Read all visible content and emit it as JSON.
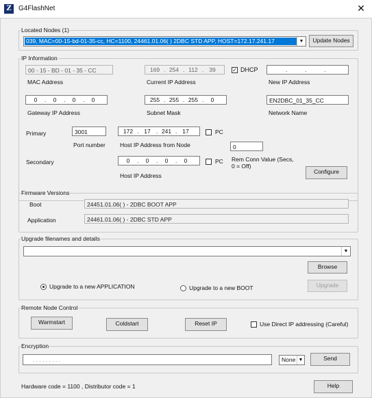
{
  "window": {
    "title": "G4FlashNet",
    "icon": "app-logo-icon",
    "close_glyph": "✕"
  },
  "nodes": {
    "legend": "Located Nodes (1)",
    "selected": "039, MAC=00-15-bd-01-35-cc, HC=1100, 24461.01.06(   ) 2DBC STD APP, HOST=172.17.241.17",
    "update_button": "Update Nodes"
  },
  "ip": {
    "legend": "IP Information",
    "mac_value": "00 - 15 - BD - 01 - 35 - CC",
    "mac_label": "MAC Address",
    "current_ip": [
      "169",
      "254",
      "112",
      "39"
    ],
    "current_ip_label": "Current IP Address",
    "dhcp_label": "DHCP",
    "dhcp_checked": true,
    "new_ip": [
      "",
      "",
      "",
      ""
    ],
    "new_ip_label": "New IP Address",
    "gateway_ip": [
      "0",
      "0",
      "0",
      "0"
    ],
    "gateway_label": "Gateway IP Address",
    "subnet": [
      "255",
      "255",
      "255",
      "0"
    ],
    "subnet_label": "Subnet Mask",
    "network_name": "EN2DBC_01_35_CC",
    "network_name_label": "Network Name",
    "primary_label": "Primary",
    "port_number": "3001",
    "port_label": "Port number",
    "host_ip": [
      "172",
      "17",
      "241",
      "17"
    ],
    "host_ip_label": "Host IP Address from Node",
    "pc_label": "PC",
    "rem_conn_value": "0",
    "rem_conn_label": "Rem Conn Value (Secs, 0 = Off)",
    "secondary_label": "Secondary",
    "secondary_ip": [
      "0",
      "0",
      "0",
      "0"
    ],
    "secondary_pc_label": "PC",
    "secondary_host_label": "Host IP Address",
    "configure_button": "Configure"
  },
  "firmware": {
    "legend": "Firmware Versions",
    "boot_label": "Boot",
    "boot_value": "24451.01.06(   ) - 2DBC BOOT APP",
    "app_label": "Application",
    "app_value": "24461.01.06(   ) - 2DBC STD APP"
  },
  "upgrade": {
    "legend": "Upgrade filenames and details",
    "filename": "",
    "browse_button": "Browse",
    "radio_app_label": "Upgrade to a new APPLICATION",
    "radio_app_checked": true,
    "radio_boot_label": "Upgrade to a new BOOT",
    "upgrade_button": "Upgrade"
  },
  "remote": {
    "legend": "Remote Node Control",
    "warmstart": "Warmstart",
    "coldstart": "Coldstart",
    "reset_ip": "Reset IP",
    "direct_ip_label": "Use Direct IP addressing (Careful)"
  },
  "encryption": {
    "legend": "Encryption",
    "key_text": ".   .   .   .   .   .   .   .   .",
    "mode": "None",
    "send_button": "Send"
  },
  "footer": {
    "hw_text": "Hardware code = 1100 , Distributor code = 1",
    "help_button": "Help"
  }
}
